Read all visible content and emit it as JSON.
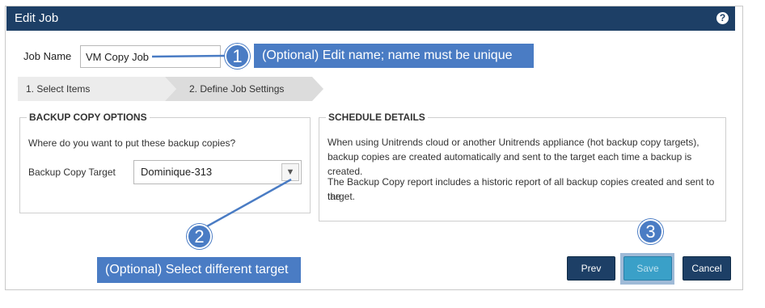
{
  "window": {
    "title": "Edit Job",
    "help_icon": "?"
  },
  "form": {
    "job_name_label": "Job Name",
    "job_name_value": "VM Copy Job"
  },
  "wizard": {
    "steps": [
      {
        "label": "1. Select Items"
      },
      {
        "label": "2. Define Job Settings"
      }
    ]
  },
  "backup_options": {
    "legend": "BACKUP COPY OPTIONS",
    "question": "Where do you want to put these backup copies?",
    "target_label": "Backup Copy Target",
    "target_value": "Dominique-313"
  },
  "schedule": {
    "legend": "SCHEDULE DETAILS",
    "paragraph1_line1": "When using Unitrends cloud or another Unitrends appliance (hot backup copy targets),",
    "paragraph1_line2": "backup copies are created automatically and sent to the target each time a backup is created.",
    "paragraph2_line1": "The Backup Copy report includes a historic report of all backup copies created and sent to the",
    "paragraph2_line2": "target."
  },
  "callouts": {
    "c1_number": "1",
    "c1_text": "(Optional) Edit name;  name must be unique",
    "c2_number": "2",
    "c2_text": "(Optional) Select different target",
    "c3_number": "3"
  },
  "buttons": {
    "prev": "Prev",
    "save": "Save",
    "cancel": "Cancel"
  },
  "colors": {
    "titlebar": "#1d3f66",
    "callout": "#4a7cc4",
    "save": "#3aa0c8"
  }
}
